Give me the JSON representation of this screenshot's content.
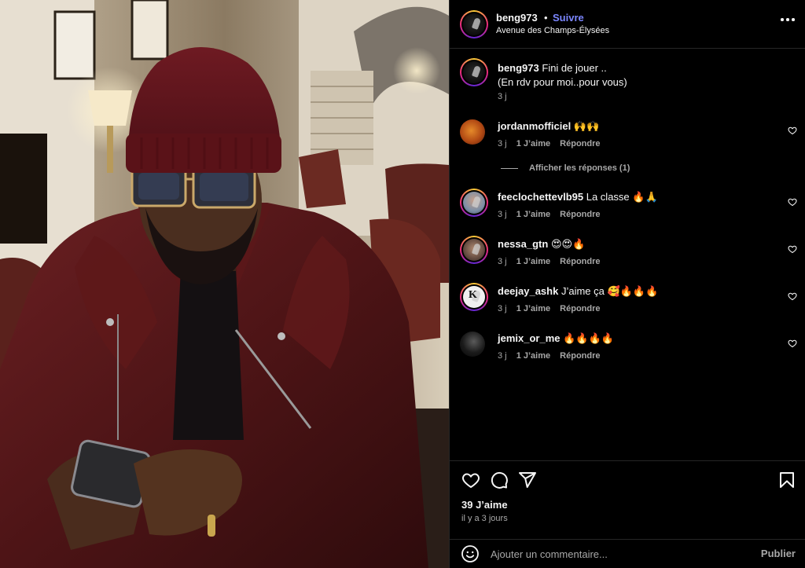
{
  "post": {
    "username": "beng973",
    "separator": "•",
    "follow_label": "Suivre",
    "location": "Avenue des Champs-Élysées",
    "more_icon": "more-horizontal-icon"
  },
  "caption": {
    "username": "beng973",
    "text_line1": "Fini de jouer ..",
    "text_line2": "(En rdv pour moi..pour vous)",
    "time": "3 j"
  },
  "comments": [
    {
      "username": "jordanmofficiel",
      "text": "🙌🙌",
      "time": "3 j",
      "likes": "1 J’aime",
      "reply": "Répondre"
    },
    {
      "username": "feeclochettevlb95",
      "text": "La classe 🔥🙏",
      "time": "3 j",
      "likes": "1 J’aime",
      "reply": "Répondre"
    },
    {
      "username": "nessa_gtn",
      "text": "😍😍🔥",
      "time": "3 j",
      "likes": "1 J’aime",
      "reply": "Répondre"
    },
    {
      "username": "deejay_ashk",
      "text": "J’aime ça 🥰🔥🔥🔥",
      "time": "3 j",
      "likes": "1 J’aime",
      "reply": "Répondre"
    },
    {
      "username": "jemix_or_me",
      "text": "🔥🔥🔥🔥",
      "time": "3 j",
      "likes": "1 J’aime",
      "reply": "Répondre"
    }
  ],
  "replies_toggle": "Afficher les réponses (1)",
  "actions": {
    "like_icon": "heart-icon",
    "comment_icon": "comment-icon",
    "share_icon": "share-icon",
    "save_icon": "bookmark-icon",
    "likes_count": "39 J’aime",
    "posted_ago": "il y a 3 jours"
  },
  "add_comment": {
    "emoji_icon": "emoji-icon",
    "placeholder": "Ajouter un commentaire...",
    "publish_label": "Publier"
  },
  "colors": {
    "background": "#000000",
    "text": "#f5f5f5",
    "secondary_text": "#a8a8a8",
    "follow_link": "#7b86ff",
    "divider": "#262626"
  }
}
